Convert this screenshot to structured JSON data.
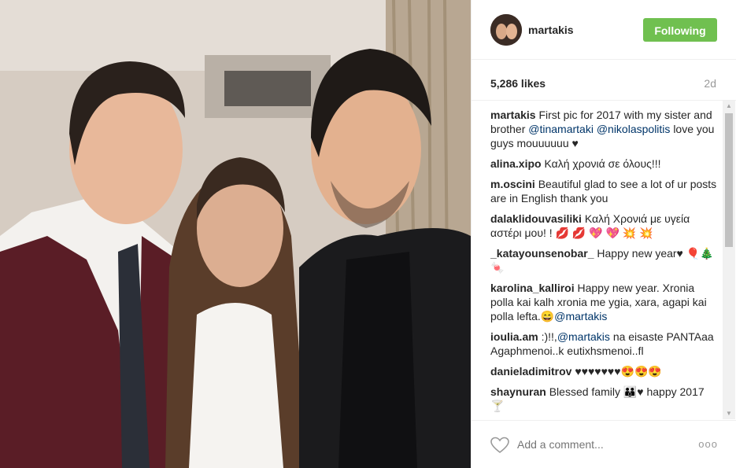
{
  "header": {
    "username": "martakis",
    "follow_label": "Following"
  },
  "stats": {
    "likes": "5,286 likes",
    "age": "2d"
  },
  "comments": [
    {
      "user": "martakis",
      "text": "First pic for 2017 with my sister and brother ",
      "mentions": [
        "@tinamartaki",
        "@nikolaspolitis"
      ],
      "tail": "love you guys mouuuuuu ♥"
    },
    {
      "user": "alina.xipo",
      "text": "Καλή χρονιά σε όλους!!!"
    },
    {
      "user": "m.oscini",
      "text": "Beautiful glad to see a lot of ur posts are in English thank you"
    },
    {
      "user": "dalaklidouvasiliki",
      "text": "Καλή Χρονιά με υγεία αστέρι μου! ! 💋 💋 💖 💖 💥 💥"
    },
    {
      "user": "_katayounsenobar_",
      "text": "Happy new year♥ 🎈🎄🍬"
    },
    {
      "user": "karolina_kalliroi",
      "text": "Happy new year. Xronia polla kai kalh xronia me ygia, xara, agapi kai polla lefta.😄",
      "mention_end": "@martakis"
    },
    {
      "user": "ioulia.am",
      "text": ":)!!,",
      "mention_mid": "@martakis",
      "tail": "na eisaste PANTAaa Agaphmenoi..k eutixhsmenoi..fl"
    },
    {
      "user": "danieladimitrov",
      "text": "♥♥♥♥♥♥♥😍😍😍"
    },
    {
      "user": "shaynuran",
      "text": "Blessed family 👪♥ happy 2017 🍸"
    }
  ],
  "footer": {
    "comment_placeholder": "Add a comment...",
    "more_label": "ooo"
  },
  "colors": {
    "follow_green": "#70c050",
    "mention_blue": "#003569"
  },
  "icons": [
    "heart-icon",
    "more-options-icon"
  ]
}
